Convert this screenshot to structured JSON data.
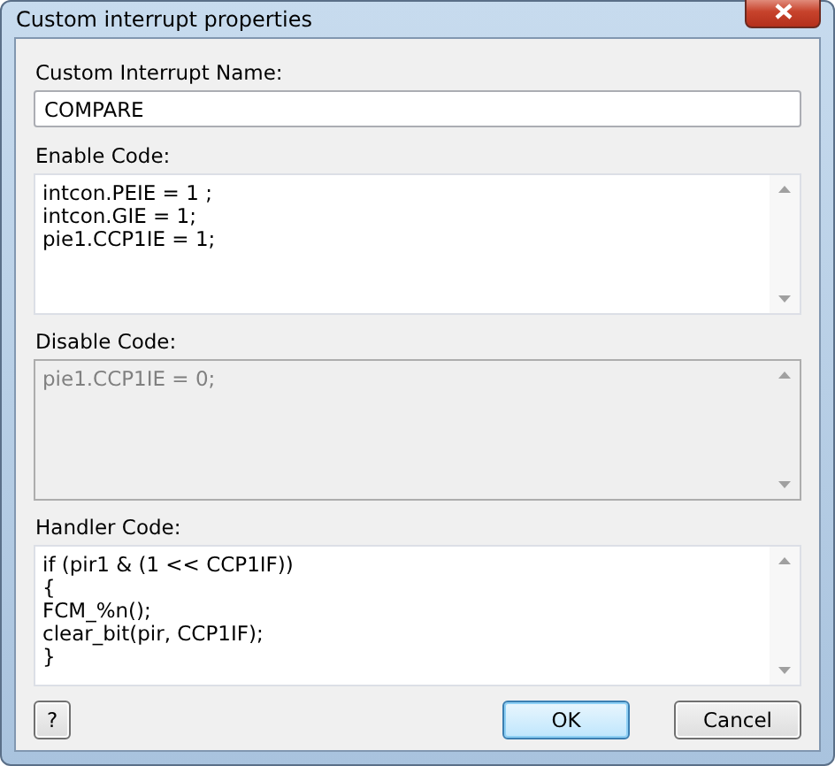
{
  "window": {
    "title": "Custom interrupt properties"
  },
  "name_field": {
    "label": "Custom Interrupt Name:",
    "value": "COMPARE"
  },
  "code_fields": [
    {
      "label": "Enable Code:",
      "disabled": false,
      "lines": [
        "intcon.PEIE = 1 ;",
        "intcon.GIE = 1;",
        "pie1.CCP1IE = 1;"
      ]
    },
    {
      "label": "Disable Code:",
      "disabled": true,
      "lines": [
        "pie1.CCP1IE = 0;"
      ]
    },
    {
      "label": "Handler Code:",
      "disabled": false,
      "lines": [
        "if (pir1 & (1 << CCP1IF))",
        "{",
        "FCM_%n();",
        "clear_bit(pir, CCP1IF);",
        "}"
      ]
    }
  ],
  "buttons": [
    {
      "kind": "help",
      "label": "?",
      "default": false
    },
    {
      "kind": "ok",
      "label": "OK",
      "default": true
    },
    {
      "kind": "cancel",
      "label": "Cancel",
      "default": false
    }
  ]
}
